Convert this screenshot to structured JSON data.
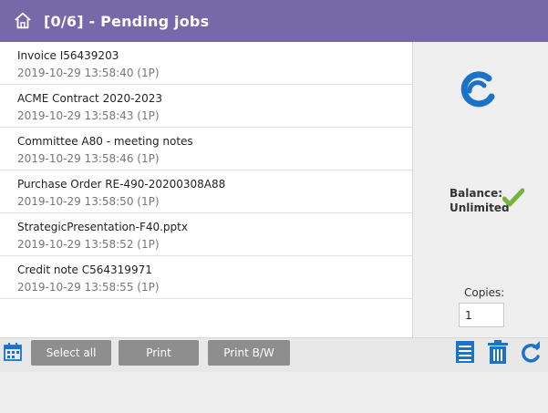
{
  "header": {
    "title": "[0/6] - Pending jobs"
  },
  "jobs": [
    {
      "name": "Invoice I56439203",
      "meta": "2019-10-29 13:58:40 (1P)"
    },
    {
      "name": "ACME Contract 2020-2023",
      "meta": "2019-10-29 13:58:43 (1P)"
    },
    {
      "name": "Committee A80 - meeting notes",
      "meta": "2019-10-29 13:58:46 (1P)"
    },
    {
      "name": "Purchase Order RE-490-20200308A88",
      "meta": "2019-10-29 13:58:50 (1P)"
    },
    {
      "name": "StrategicPresentation-F40.pptx",
      "meta": "2019-10-29 13:58:52 (1P)"
    },
    {
      "name": "Credit note C564319971",
      "meta": "2019-10-29 13:58:55 (1P)"
    }
  ],
  "side": {
    "balance_label": "Balance:",
    "balance_value": "Unlimited",
    "copies_label": "Copies:",
    "copies_value": "1"
  },
  "toolbar": {
    "select_all": "Select all",
    "print": "Print",
    "print_bw": "Print B/W"
  },
  "colors": {
    "header": "#7769a9",
    "button": "#8e8e8e",
    "accent_blue": "#1a73c8",
    "check_green": "#79b43a"
  },
  "icons": {
    "home": "home-icon",
    "logo": "refresh-logo-icon",
    "check": "check-icon",
    "calendar": "calendar-icon",
    "details": "document-list-icon",
    "delete": "trash-icon",
    "refresh": "refresh-icon"
  }
}
